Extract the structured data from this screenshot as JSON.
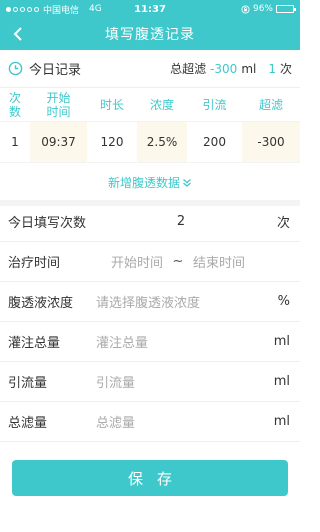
{
  "status_bar": {
    "carrier": "中国电信",
    "network": "4G",
    "time": "11:37",
    "battery": "96%",
    "battery_level": 0.96
  },
  "nav": {
    "back_icon": "chevron-left-icon",
    "title": "填写腹透记录"
  },
  "summary": {
    "icon": "clock-icon",
    "title": "今日记录",
    "total_label": "总超滤",
    "total_value": "-300",
    "total_unit": "ml",
    "count": "1",
    "count_unit": "次"
  },
  "table": {
    "headers": [
      [
        "次",
        "数"
      ],
      [
        "开始",
        "时间"
      ],
      [
        "时长"
      ],
      [
        "浓度"
      ],
      [
        "引流"
      ],
      [
        "超滤"
      ]
    ],
    "rows": [
      [
        "1",
        "09:37",
        "120",
        "2.5%",
        "200",
        "-300"
      ]
    ]
  },
  "add_more": {
    "label": "新增腹透数据",
    "icon": "double-chevron-down-icon"
  },
  "form": {
    "today_count": {
      "label": "今日填写次数",
      "value": "2",
      "unit": "次"
    },
    "treatment_time": {
      "label": "治疗时间",
      "start_placeholder": "开始时间",
      "separator": "~",
      "end_placeholder": "结束时间"
    },
    "concentration": {
      "label": "腹透液浓度",
      "placeholder": "请选择腹透液浓度",
      "unit": "%"
    },
    "infusion": {
      "label": "灌注总量",
      "placeholder": "灌注总量",
      "unit": "ml"
    },
    "drainage": {
      "label": "引流量",
      "placeholder": "引流量",
      "unit": "ml"
    },
    "ultrafiltration": {
      "label": "总滤量",
      "placeholder": "总滤量",
      "unit": "ml"
    }
  },
  "save_label": "保存",
  "colors": {
    "accent": "#3fc8cb",
    "row_shade": "#fdf8ec",
    "placeholder": "#aaaaaa"
  }
}
